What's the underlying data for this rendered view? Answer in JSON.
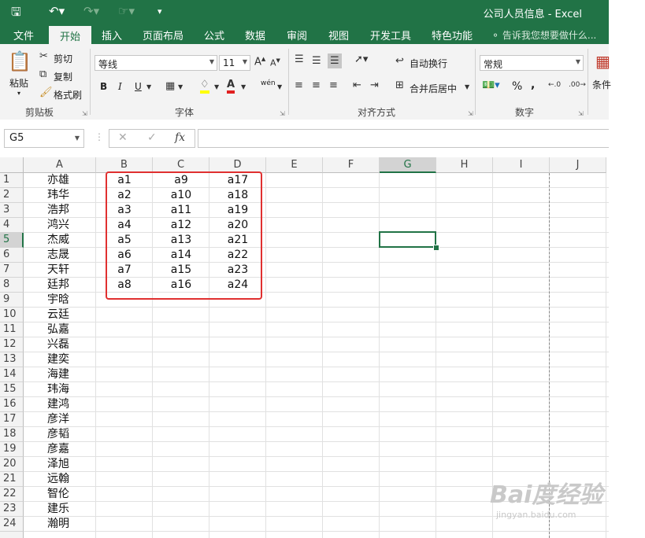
{
  "titlebar": {
    "title": "公司人员信息 - Excel",
    "icons": [
      "save-icon",
      "undo-icon",
      "redo-icon",
      "touch-mode-icon",
      "customize-qat-icon"
    ]
  },
  "tabs": [
    {
      "label": "文件"
    },
    {
      "label": "开始"
    },
    {
      "label": "插入"
    },
    {
      "label": "页面布局"
    },
    {
      "label": "公式"
    },
    {
      "label": "数据"
    },
    {
      "label": "审阅"
    },
    {
      "label": "视图"
    },
    {
      "label": "开发工具"
    },
    {
      "label": "特色功能"
    }
  ],
  "tellme": "告诉我您想要做什么...",
  "ribbon": {
    "clipboard": {
      "paste": "粘贴",
      "cut": "剪切",
      "copy": "复制",
      "format_painter": "格式刷",
      "label": "剪贴板"
    },
    "font": {
      "name": "等线",
      "size": "11",
      "label": "字体",
      "bold": "B",
      "italic": "I",
      "underline": "U",
      "phonetic": "wén"
    },
    "alignment": {
      "wrap": "自动换行",
      "merge": "合并后居中",
      "label": "对齐方式"
    },
    "number": {
      "format": "常规",
      "percent": "%",
      "comma": ",",
      "label": "数字"
    },
    "styles": {
      "conditional": "条件"
    }
  },
  "formula_bar": {
    "name_box": "G5",
    "fx": "fx",
    "value": ""
  },
  "columns": [
    "A",
    "B",
    "C",
    "D",
    "E",
    "F",
    "G",
    "H",
    "I",
    "J"
  ],
  "rows": [
    "1",
    "2",
    "3",
    "4",
    "5",
    "6",
    "7",
    "8",
    "9",
    "10",
    "11",
    "12",
    "13",
    "14",
    "15",
    "16",
    "17",
    "18",
    "19",
    "20",
    "21",
    "22",
    "23",
    "24"
  ],
  "col_a": [
    "亦雄",
    "玮华",
    "浩邦",
    "鸿兴",
    "杰威",
    "志晟",
    "天轩",
    "廷邦",
    "宇晗",
    "云廷",
    "弘嘉",
    "兴磊",
    "建奕",
    "海建",
    "玮海",
    "建鸿",
    "彦洋",
    "彦韬",
    "彦嘉",
    "泽旭",
    "远翰",
    "智伦",
    "建乐",
    "瀚明"
  ],
  "col_b": [
    "a1",
    "a2",
    "a3",
    "a4",
    "a5",
    "a6",
    "a7",
    "a8"
  ],
  "col_c": [
    "a9",
    "a10",
    "a11",
    "a12",
    "a13",
    "a14",
    "a15",
    "a16"
  ],
  "col_d": [
    "a17",
    "a18",
    "a19",
    "a20",
    "a21",
    "a22",
    "a23",
    "a24"
  ],
  "selected_cell": "G5",
  "watermark": {
    "main": "Bai度经验",
    "sub": "jingyan.baidu.com"
  },
  "colors": {
    "accent": "#217346",
    "highlight_box": "#e03030"
  }
}
